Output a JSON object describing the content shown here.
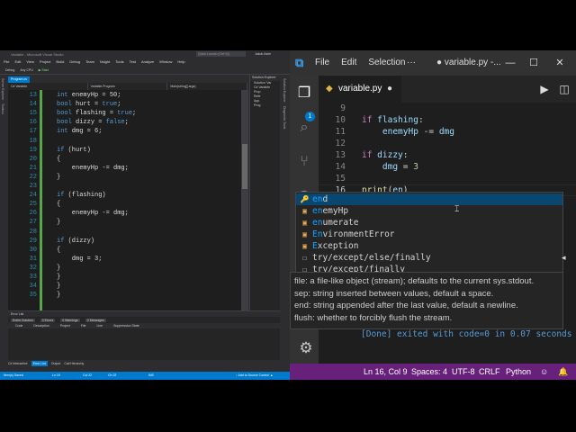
{
  "vs": {
    "title": "Variable - Microsoft Visual Studio",
    "quick_launch": "Quick Launch (Ctrl+Q)",
    "user": "Jakob Ashe",
    "menu": [
      "File",
      "Edit",
      "View",
      "Project",
      "Build",
      "Debug",
      "Team",
      "Nsight",
      "Tools",
      "Test",
      "Analyze",
      "Window",
      "Help"
    ],
    "toolbar": {
      "config": "Debug",
      "platform": "Any CPU",
      "start": "▶ Start"
    },
    "doc_tab": "Program.cs",
    "left_tool_tabs": [
      "Server Explorer",
      "Toolbox"
    ],
    "right_tool_tabs": [
      "Solution Explorer",
      "Diagnostic Tools"
    ],
    "nav": [
      "C# Variable",
      "Variable.Program",
      "Main(string[] args)"
    ],
    "lines": [
      {
        "n": "13",
        "code": "int enemyHp = 50;"
      },
      {
        "n": "14",
        "code": "bool hurt = true;"
      },
      {
        "n": "15",
        "code": "bool flashing = true;"
      },
      {
        "n": "16",
        "code": "bool dizzy = false;"
      },
      {
        "n": "17",
        "code": "int dmg = 6;"
      },
      {
        "n": "18",
        "code": ""
      },
      {
        "n": "19",
        "code": "if (hurt)"
      },
      {
        "n": "20",
        "code": "{"
      },
      {
        "n": "21",
        "code": "    enemyHp -= dmg;"
      },
      {
        "n": "22",
        "code": "}"
      },
      {
        "n": "23",
        "code": ""
      },
      {
        "n": "24",
        "code": "if (flashing)"
      },
      {
        "n": "25",
        "code": "{"
      },
      {
        "n": "26",
        "code": "    enemyHp -= dmg;"
      },
      {
        "n": "27",
        "code": "}"
      },
      {
        "n": "28",
        "code": ""
      },
      {
        "n": "29",
        "code": "if (dizzy)"
      },
      {
        "n": "30",
        "code": "{"
      },
      {
        "n": "31",
        "code": "    dmg = 3;"
      },
      {
        "n": "32",
        "code": "}"
      },
      {
        "n": "33",
        "code": "}"
      },
      {
        "n": "34",
        "code": "}"
      },
      {
        "n": "35",
        "code": "}"
      }
    ],
    "solution": {
      "header": "Solution Explorer",
      "rows": [
        "Solution 'Var",
        "C# Variable",
        "Prop",
        "Refe",
        "App.",
        "Prog"
      ]
    },
    "error_list": {
      "title": "Error List",
      "scope": "Entire Solution",
      "errors": "0 Errors",
      "warnings": "0 Warnings",
      "messages": "0 Messages",
      "columns": [
        "Code",
        "Description",
        "Project",
        "File",
        "Line",
        "Suppression State"
      ]
    },
    "bottom_tabs": [
      "C# Interactive",
      "Error List",
      "Output",
      "Call Hierarchy"
    ],
    "status": {
      "left": "Item(s) Saved",
      "ln": "Ln 19",
      "col": "Col 22",
      "ch": "Ch 22",
      "ins": "INS",
      "source": "↑ Add to Source Control ▲"
    }
  },
  "vscode": {
    "menu": [
      "File",
      "Edit",
      "Selection"
    ],
    "more": "···",
    "window_title": "● variable.py -...",
    "window_controls": [
      "—",
      "☐",
      "✕"
    ],
    "tab_label": "variable.py",
    "tab_dirty": "●",
    "activity_badge": "1",
    "lines": [
      {
        "n": "9",
        "tokens": []
      },
      {
        "n": "10",
        "tokens": [
          [
            "ckw",
            "if "
          ],
          [
            "cvar",
            "flashing"
          ],
          [
            "",
            ":"
          ]
        ]
      },
      {
        "n": "11",
        "tokens": [
          [
            "",
            "    "
          ],
          [
            "cvar",
            "enemyHp"
          ],
          [
            "",
            " -= "
          ],
          [
            "cvar",
            "dmg"
          ]
        ]
      },
      {
        "n": "12",
        "tokens": []
      },
      {
        "n": "13",
        "tokens": [
          [
            "ckw",
            "if "
          ],
          [
            "cvar",
            "dizzy"
          ],
          [
            "",
            ":"
          ]
        ]
      },
      {
        "n": "14",
        "tokens": [
          [
            "",
            "    "
          ],
          [
            "cvar",
            "dmg"
          ],
          [
            "",
            " = "
          ],
          [
            "cnum",
            "3"
          ]
        ]
      },
      {
        "n": "15",
        "tokens": []
      },
      {
        "n": "16",
        "tokens": [
          [
            "cfn",
            "print"
          ],
          [
            "",
            "("
          ],
          [
            "cvar",
            "en"
          ],
          [
            "",
            ")"
          ]
        ]
      }
    ],
    "suggestions": [
      {
        "icon": "🔑",
        "label": "end",
        "match": "en",
        "rest": "d"
      },
      {
        "icon": "▣",
        "label": "enemyHp",
        "match": "en",
        "rest": "emyHp"
      },
      {
        "icon": "▣",
        "label": "enumerate",
        "match": "en",
        "rest": "umerate"
      },
      {
        "icon": "▣",
        "label": "EnvironmentError",
        "match": "En",
        "rest": "vironmentError"
      },
      {
        "icon": "▣",
        "label": "Exception",
        "match": "E",
        "rest": "xception"
      },
      {
        "icon": "☐",
        "label": "try/except/else/finally",
        "match": "",
        "rest": "try/except/else/finally"
      },
      {
        "icon": "☐",
        "label": "try/except/finally",
        "match": "",
        "rest": "try/except/finally"
      }
    ],
    "docs": [
      "file:  a file-like object (stream); defaults to the current sys.stdout.",
      "sep:   string inserted between values, default a space.",
      "end:   string appended after the last value, default a newline.",
      "flush: whether to forcibly flush the stream."
    ],
    "run_output": "[Done] exited with code=0 in 0.07 seconds",
    "status": {
      "position": "Ln 16, Col 9",
      "spaces": "Spaces: 4",
      "encoding": "UTF-8",
      "eol": "CRLF",
      "language": "Python",
      "smiley": "☺",
      "bell": "🔔"
    }
  },
  "colors": {
    "vs_accent": "#007acc",
    "vscode_status": "#68217a",
    "selected_suggestion": "#094771"
  }
}
